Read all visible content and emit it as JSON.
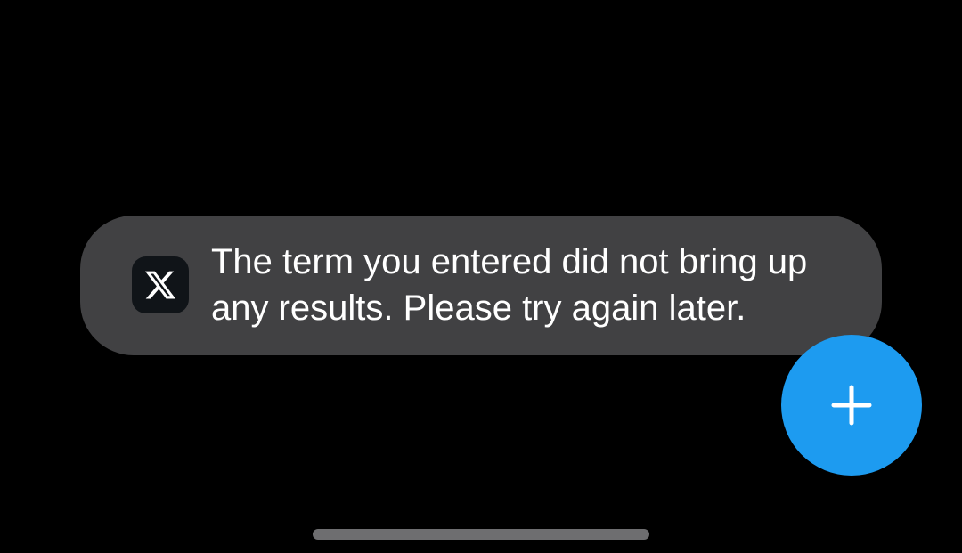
{
  "toast": {
    "app_icon": "x-logo-icon",
    "message": "The term you entered did not bring up any results. Please try again later."
  },
  "fab": {
    "icon": "plus-icon",
    "color": "#1d9bf0"
  },
  "colors": {
    "background": "#000000",
    "toast_background": "#414143",
    "toast_text": "#ffffff",
    "icon_background": "#101418",
    "home_indicator": "#6e6e70"
  }
}
